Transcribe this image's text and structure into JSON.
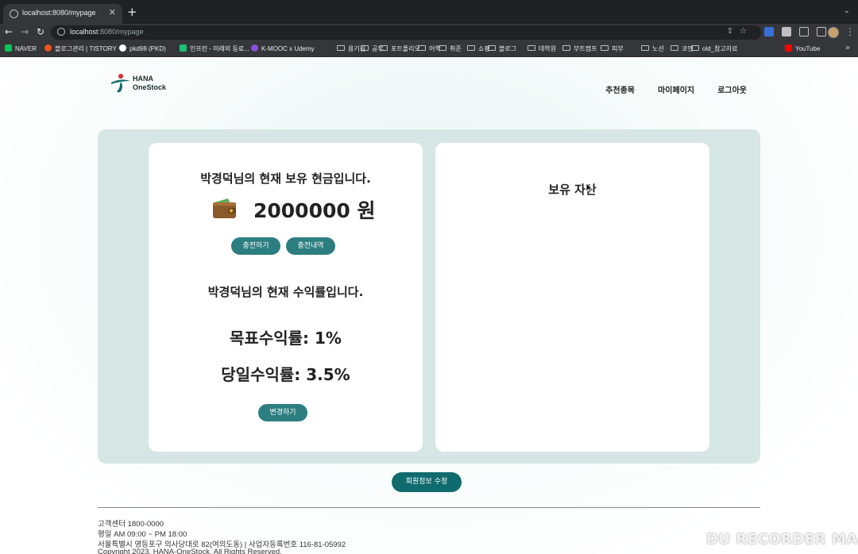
{
  "browser": {
    "tab_title": "localhost:8080/mypage",
    "url_host": "localhost",
    "url_path": ":8080/mypage",
    "bookmarks": [
      {
        "label": "NAVER",
        "icon": "naver-icon",
        "color": "#03c75a"
      },
      {
        "label": "블로그관리 | TISTORY",
        "icon": "tistory-icon",
        "color": "#eb531f"
      },
      {
        "label": "pkd98 (PKD)",
        "icon": "github-icon",
        "color": "#ffffff"
      },
      {
        "label": "인프런 - 미래의 동료...",
        "icon": "inflearn-icon",
        "color": "#1dc078"
      },
      {
        "label": "K-MOOC x Udemy",
        "icon": "kmooc-icon",
        "color": "#8a4fd8"
      },
      {
        "label": "용기원",
        "icon": "folder-icon"
      },
      {
        "label": "공부",
        "icon": "folder-icon"
      },
      {
        "label": "포트폴리오",
        "icon": "folder-icon"
      },
      {
        "label": "어학",
        "icon": "folder-icon"
      },
      {
        "label": "취준",
        "icon": "folder-icon"
      },
      {
        "label": "쇼핑",
        "icon": "folder-icon"
      },
      {
        "label": "블로그",
        "icon": "folder-icon"
      },
      {
        "label": "대학원",
        "icon": "folder-icon"
      },
      {
        "label": "부트캠프",
        "icon": "folder-icon"
      },
      {
        "label": "피부",
        "icon": "folder-icon"
      },
      {
        "label": "노션",
        "icon": "folder-icon"
      },
      {
        "label": "코인",
        "icon": "folder-icon"
      },
      {
        "label": "old_참고자료",
        "icon": "folder-icon"
      },
      {
        "label": "YouTube",
        "icon": "youtube-icon",
        "color": "#ff0000"
      }
    ]
  },
  "header": {
    "logo_line1": "HANA",
    "logo_line2": "OneStock",
    "nav": [
      "추천종목",
      "마이페이지",
      "로그아웃"
    ]
  },
  "cash": {
    "title": "박경덕님의 현재 보유 현금입니다.",
    "amount": "2000000 원",
    "charge_label": "충전하기",
    "history_label": "충전내역"
  },
  "returns": {
    "title": "박경덕님의 현재 수익률입니다.",
    "target": "목표수익률: 1%",
    "daily": "당일수익률: 3.5%",
    "change_label": "변경하기"
  },
  "assets": {
    "title": "보유 자산"
  },
  "edit_profile_label": "회원정보 수정",
  "footer": {
    "line1": "고객센터 1800-0000",
    "line2": "평일 AM 09:00 ~ PM 18:00",
    "line3": "서울특별시 영등포구 의사당대로 82(여의도동) | 사업자등록번호 116-81-05992",
    "line4": "Copyright 2023. HANA-OneStock. All Rights Reserved."
  },
  "watermark": "DU RECORDER MAC",
  "colors": {
    "accent": "#2c7e80",
    "accent_dark": "#0f6b6e",
    "panel_bg": "#d5e6e4"
  }
}
